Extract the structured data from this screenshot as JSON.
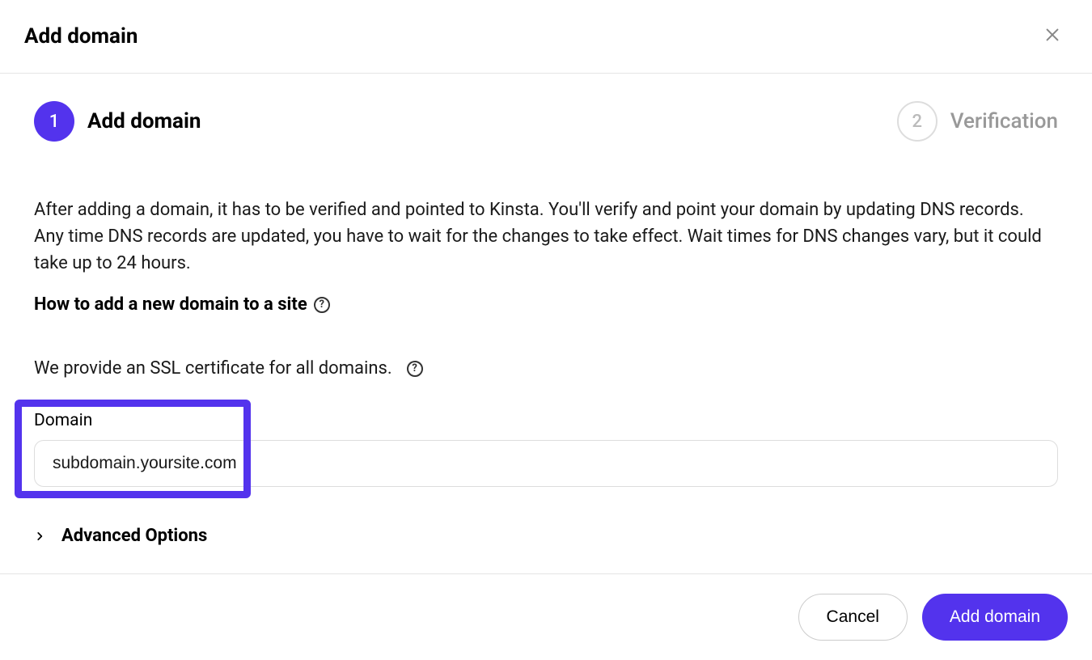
{
  "header": {
    "title": "Add domain"
  },
  "steps": {
    "step1": {
      "number": "1",
      "label": "Add domain"
    },
    "step2": {
      "number": "2",
      "label": "Verification"
    }
  },
  "info_text": "After adding a domain, it has to be verified and pointed to Kinsta. You'll verify and point your domain by updating DNS records. Any time DNS records are updated, you have to wait for the changes to take effect. Wait times for DNS changes vary, but it could take up to 24 hours.",
  "help_link": "How to add a new domain to a site",
  "ssl_text": "We provide an SSL certificate for all domains.",
  "domain_field": {
    "label": "Domain",
    "value": "subdomain.yoursite.com"
  },
  "advanced_label": "Advanced Options",
  "footer": {
    "cancel": "Cancel",
    "submit": "Add domain"
  },
  "icons": {
    "help_glyph": "?"
  }
}
